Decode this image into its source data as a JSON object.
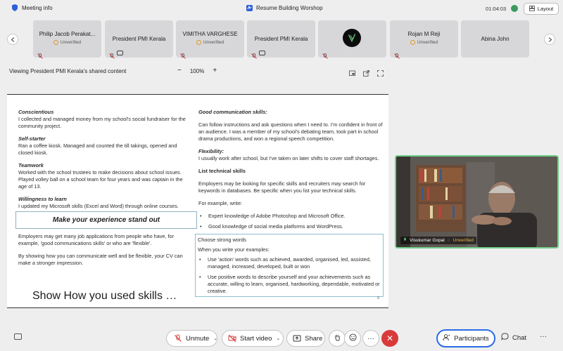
{
  "topbar": {
    "meeting_info": "Meeting info",
    "title": "Resume Building Worshop",
    "timer": "01:04:03",
    "layout_label": "Layout"
  },
  "participants": [
    {
      "name": "Philip Jacob Perakat...",
      "status": "Unverified",
      "mic": "off",
      "video": "off"
    },
    {
      "name": "President PMI Kerala",
      "status": "",
      "mic": "off",
      "video": "share"
    },
    {
      "name": "VIMITHA VARGHESE",
      "status": "Unverified",
      "mic": "off",
      "video": "off"
    },
    {
      "name": "President PMI Kerala",
      "status": "",
      "mic": "off",
      "video": "share"
    },
    {
      "name": "",
      "status": "",
      "mic": "off",
      "avatar": "logo"
    },
    {
      "name": "Rojan M Reji",
      "status": "Unverified",
      "mic": "off",
      "video": "off"
    },
    {
      "name": "Abina John",
      "status": "",
      "mic": "",
      "video": ""
    }
  ],
  "share_bar": {
    "label": "Viewing President PMI Kerala's shared content",
    "zoom": "100%",
    "minus": "−",
    "plus": "+"
  },
  "doc": {
    "left": [
      {
        "heading": "Conscientious",
        "text": "I collected and managed money from my school's social fundraiser for the community project."
      },
      {
        "heading": "Self-starter",
        "text": "Ran a coffee kiosk. Managed and counted the till takings, opened and closed kiosk."
      },
      {
        "heading": "Teamwork",
        "text": "Worked with the school trustees to make decisions about school issues. Played volley ball on a school team for four years and was captain in the age of 13."
      },
      {
        "heading": "Willingness to learn",
        "text": "I updated my Microsoft skills (Excel and Word) through online courses."
      }
    ],
    "stand_out": "Make your experience stand out",
    "left_after": [
      "Employers may get many job applications from people who have, for example, 'good communications skills' or who are 'flexible'.",
      "By showing how you can communicate well and be flexible, your CV can make a stronger impression."
    ],
    "big_heading": "Show How you used skills …",
    "page_number": "9",
    "right": {
      "comm_heading": "Good communication skills:",
      "comm_text": "Can follow instructions and ask questions when I need to. I'm confident in front of an audience. I was a member of my school's debating team, took part in school drama productions, and won a regional speech competition.",
      "flex_heading": "Flexibility:",
      "flex_text": "I usually work after school, but I've taken on later shifts to cover staff shortages.",
      "tech_heading": "List technical skills",
      "tech_text": "Employers may be looking for specific skills and recruiters may search for keywords in databases. Be specific when you list your technical skills.",
      "example_label": "For example, write:",
      "tech_bullets": [
        "Expert knowledge of Adobe Photoshop and Microsoft Office.",
        "Good knowledge of social media platforms and WordPress."
      ],
      "strong_heading": "Choose strong words",
      "strong_intro": "When you write your examples:",
      "strong_bullets": [
        "Use 'action' words such as achieved, awarded, organised, led, assisted, managed, increased, developed, built or won",
        "Use positive words to describe yourself and your achievements such as accurate, willing to learn, organised, hardworking, dependable, motivated or creative."
      ]
    }
  },
  "video": {
    "name": "Visukumar Gopal",
    "status": "Unverified",
    "border_color": "#6fcf8a"
  },
  "toolbar": {
    "unmute": "Unmute",
    "start_video": "Start video",
    "share": "Share",
    "more": "···",
    "participants": "Participants",
    "chat": "Chat",
    "more_right": "···"
  },
  "colors": {
    "accent": "#2b6be8",
    "leave": "#d93a3a",
    "unverified": "#d99a2b"
  }
}
